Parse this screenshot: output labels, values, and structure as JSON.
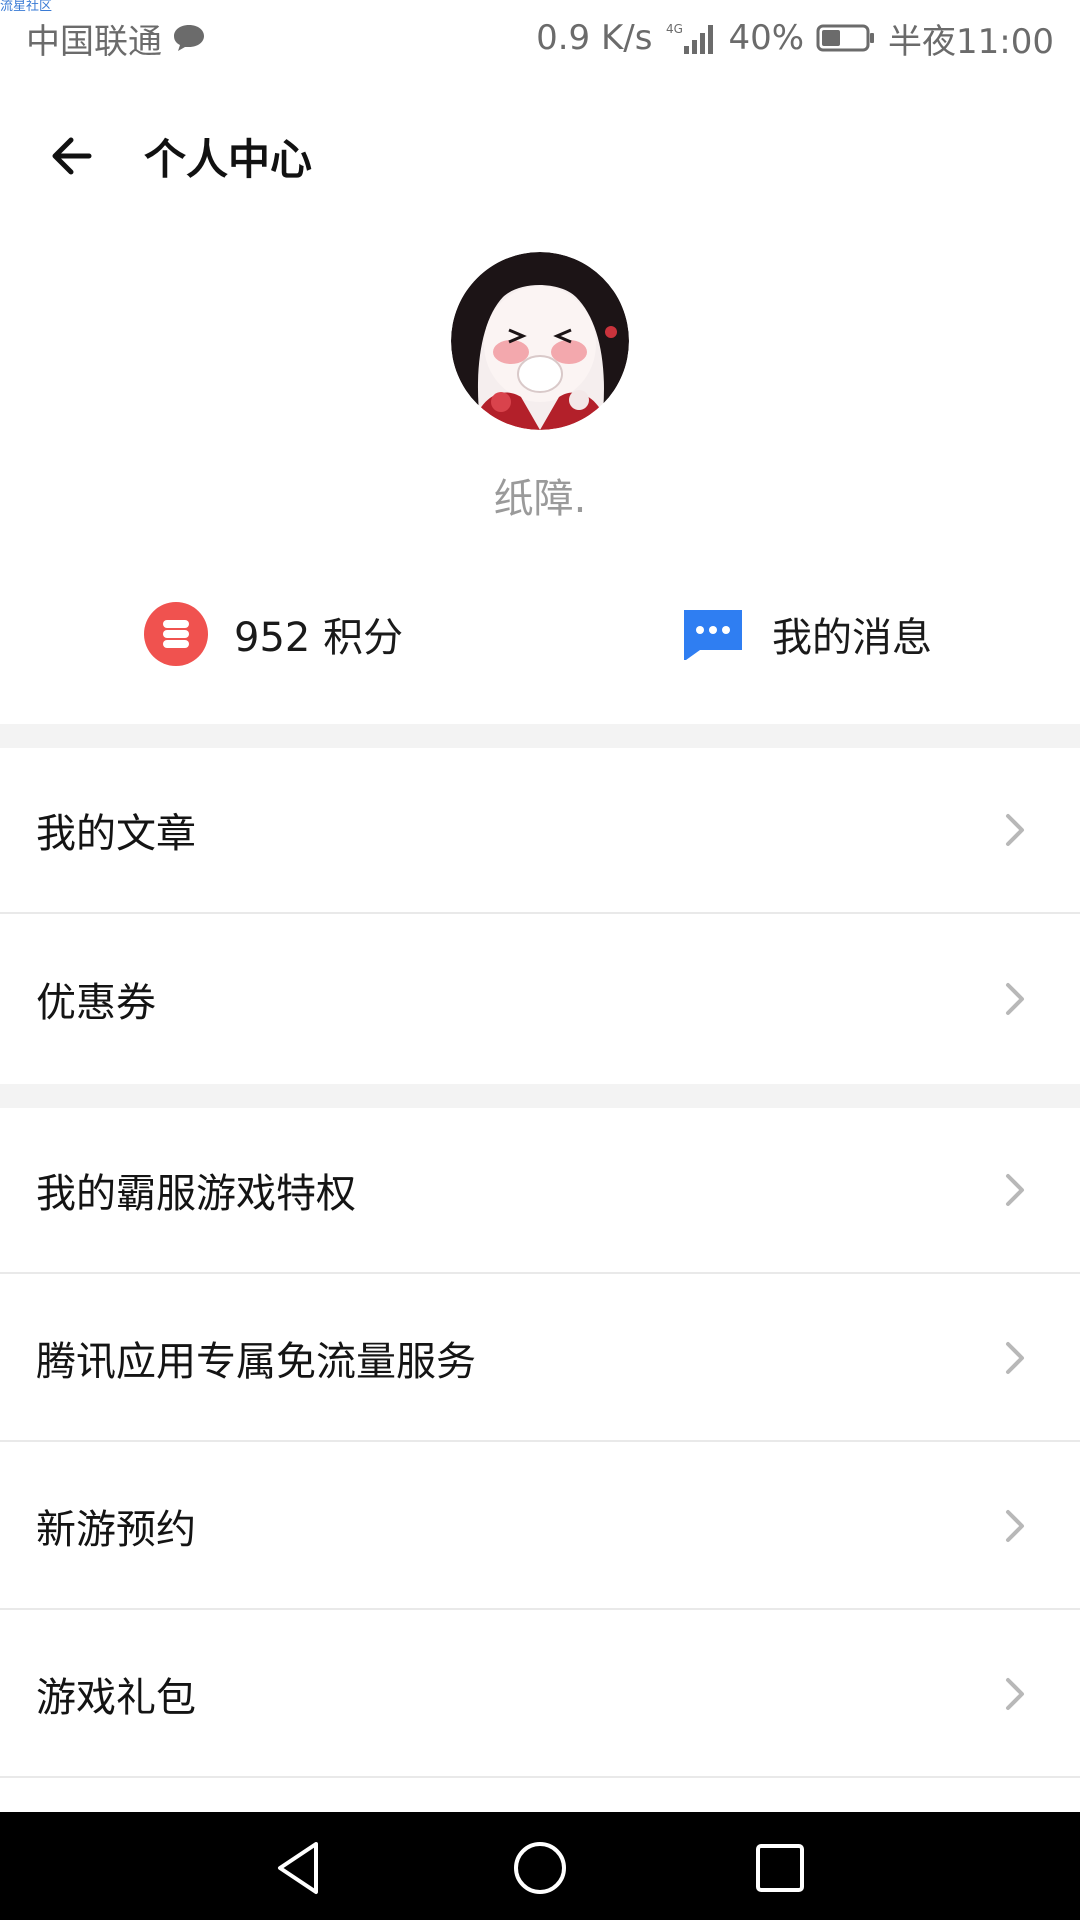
{
  "watermark": "流星社区",
  "status_bar": {
    "carrier": "中国联通",
    "net_speed": "0.9 K/s",
    "battery_percent": "40%",
    "time": "半夜11:00",
    "icons": [
      "chat-bubble-icon",
      "signal-4g-icon",
      "battery-icon"
    ]
  },
  "header": {
    "title": "个人中心",
    "back_icon": "arrow-left-icon"
  },
  "profile": {
    "username": "纸障."
  },
  "quick_actions": {
    "points_value": "952",
    "points_label": "积分",
    "messages_label": "我的消息"
  },
  "menu": {
    "group1": [
      {
        "label": "我的文章"
      },
      {
        "label": "优惠券"
      }
    ],
    "group2": [
      {
        "label": "我的霸服游戏特权"
      },
      {
        "label": "腾讯应用专属免流量服务"
      },
      {
        "label": "新游预约"
      },
      {
        "label": "游戏礼包"
      }
    ]
  },
  "colors": {
    "points_icon": "#f0524f",
    "messages_icon": "#2f7ef2",
    "separator": "#f3f3f3"
  }
}
